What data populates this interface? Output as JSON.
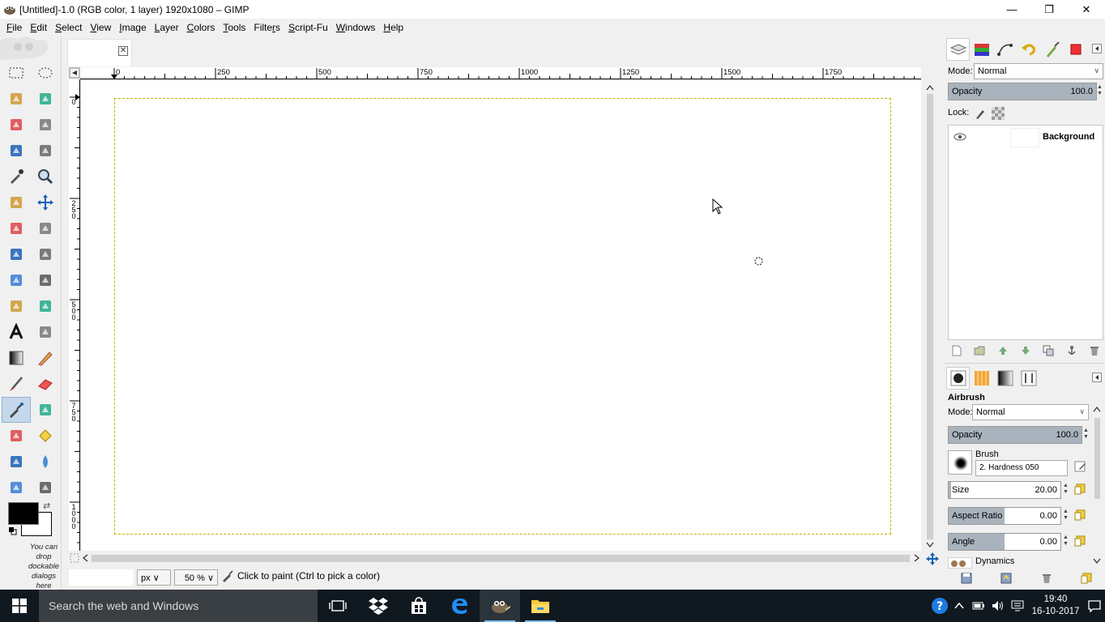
{
  "window": {
    "title": "[Untitled]-1.0 (RGB color, 1 layer) 1920x1080 – GIMP",
    "minimize": "—",
    "restore": "❐",
    "close": "✕"
  },
  "menu": [
    "File",
    "Edit",
    "Select",
    "View",
    "Image",
    "Layer",
    "Colors",
    "Tools",
    "Filters",
    "Script-Fu",
    "Windows",
    "Help"
  ],
  "menu_underline": [
    "F",
    "E",
    "S",
    "V",
    "I",
    "L",
    "C",
    "T",
    "r",
    "S",
    "W",
    "H"
  ],
  "toolbox": {
    "dock_hint": "You can drop dockable dialogs here",
    "tools": [
      "rect-select-icon",
      "ellipse-select-icon",
      "free-select-icon",
      "fuzzy-select-icon",
      "select-by-color-icon",
      "scissors-icon",
      "foreground-select-icon",
      "paths-icon",
      "color-picker-icon",
      "zoom-icon",
      "measure-icon",
      "move-icon",
      "align-icon",
      "crop-icon",
      "rotate-icon",
      "scale-icon",
      "shear-icon",
      "perspective-icon",
      "flip-icon",
      "cage-icon",
      "text-icon",
      "bucket-fill-icon",
      "blend-icon",
      "pencil-icon",
      "paintbrush-icon",
      "eraser-icon",
      "airbrush-icon",
      "ink-icon",
      "clone-icon",
      "heal-icon",
      "perspective-clone-icon",
      "blur-icon",
      "smudge-icon",
      "dodge-burn-icon"
    ],
    "active_tool_index": 26,
    "fg_color": "#000000",
    "bg_color": "#ffffff"
  },
  "image_window": {
    "ruler_h_labels": [
      "0",
      "250",
      "500",
      "750",
      "1000",
      "1250",
      "1500",
      "1750"
    ],
    "ruler_v_labels": [
      "0",
      "250",
      "500",
      "750",
      "1000"
    ],
    "status": {
      "unit": "px",
      "zoom": "50 %",
      "message": "Click to paint (Ctrl to pick a color)"
    }
  },
  "dock": {
    "layers": {
      "mode_label": "Mode:",
      "mode_value": "Normal",
      "opacity_label": "Opacity",
      "opacity_value": "100.0",
      "lock_label": "Lock:",
      "layer_name": "Background"
    },
    "tool_options": {
      "title": "Airbrush",
      "mode_label": "Mode:",
      "mode_value": "Normal",
      "opacity_label": "Opacity",
      "opacity_value": "100.0",
      "brush_label": "Brush",
      "brush_value": "2. Hardness 050",
      "size_label": "Size",
      "size_value": "20.00",
      "aspect_label": "Aspect Ratio",
      "aspect_value": "0.00",
      "angle_label": "Angle",
      "angle_value": "0.00",
      "dynamics_label": "Dynamics"
    }
  },
  "taskbar": {
    "search_placeholder": "Search the web and Windows",
    "time": "19:40",
    "date": "16-10-2017"
  }
}
